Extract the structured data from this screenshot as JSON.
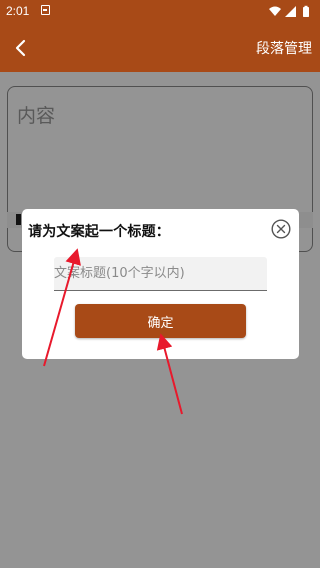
{
  "status_bar": {
    "time": "2:01",
    "icons": [
      "notification-icon",
      "wifi-icon",
      "signal-icon",
      "battery-icon"
    ]
  },
  "app_bar": {
    "back_icon": "back-arrow-icon",
    "title": "段落管理"
  },
  "editor": {
    "placeholder": "内容"
  },
  "dialog": {
    "title": "请为文案起一个标题：",
    "close_icon": "close-circle-icon",
    "input_placeholder": "文案标题(10个字以内)",
    "input_value": "",
    "confirm_label": "确定"
  },
  "colors": {
    "brand": "#a84a17",
    "annotation_arrow": "#e8192c"
  }
}
